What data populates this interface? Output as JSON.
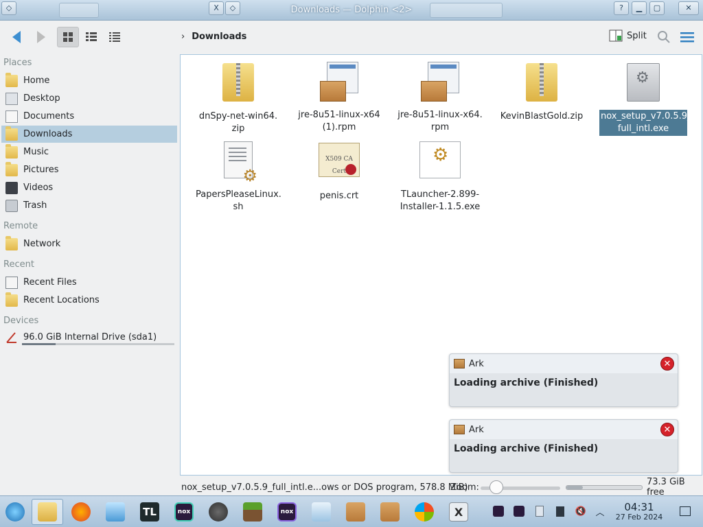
{
  "window": {
    "title": "Downloads — Dolphin <2>"
  },
  "toolbar": {
    "split_label": "Split"
  },
  "breadcrumb": {
    "current": "Downloads"
  },
  "sidebar": {
    "sections": {
      "places": "Places",
      "remote": "Remote",
      "recent": "Recent",
      "devices": "Devices"
    },
    "places": [
      {
        "label": "Home",
        "icon": "home-icon"
      },
      {
        "label": "Desktop",
        "icon": "desktop-icon"
      },
      {
        "label": "Documents",
        "icon": "documents-icon"
      },
      {
        "label": "Downloads",
        "icon": "downloads-icon"
      },
      {
        "label": "Music",
        "icon": "music-icon"
      },
      {
        "label": "Pictures",
        "icon": "pictures-icon"
      },
      {
        "label": "Videos",
        "icon": "videos-icon"
      },
      {
        "label": "Trash",
        "icon": "trash-icon"
      }
    ],
    "remote": [
      {
        "label": "Network",
        "icon": "network-icon"
      }
    ],
    "recent": [
      {
        "label": "Recent Files",
        "icon": "recent-files-icon"
      },
      {
        "label": "Recent Locations",
        "icon": "recent-locations-icon"
      }
    ],
    "devices": [
      {
        "label": "96.0 GiB Internal Drive (sda1)",
        "icon": "drive-icon",
        "usage_fraction": 0.22
      }
    ]
  },
  "files": [
    {
      "line1": "dnSpy-net-win64.",
      "line2": "zip",
      "type": "zip"
    },
    {
      "line1": "jre-8u51-linux-x64",
      "line2": "(1).rpm",
      "type": "rpm"
    },
    {
      "line1": "jre-8u51-linux-x64.",
      "line2": "rpm",
      "type": "rpm"
    },
    {
      "line1": "KevinBlastGold.zip",
      "line2": "",
      "type": "zip"
    },
    {
      "line1": "nox_setup_v7.0.5.9_",
      "line2": "full_intl.exe",
      "type": "exe",
      "selected": true
    },
    {
      "line1": "PapersPleaseLinux.",
      "line2": "sh",
      "type": "script"
    },
    {
      "line1": "penis.crt",
      "line2": "",
      "type": "cert",
      "cert_text": "X509 CA Cert"
    },
    {
      "line1": "TLauncher-2.899-",
      "line2": "Installer-1.1.5.exe",
      "type": "tlauncher"
    }
  ],
  "notifications": [
    {
      "app": "Ark",
      "message": "Loading archive (Finished)"
    },
    {
      "app": "Ark",
      "message": "Loading archive (Finished)"
    }
  ],
  "statusbar": {
    "selection_info": "nox_setup_v7.0.5.9_full_intl.e...ows or DOS program, 578.8 MiB)",
    "zoom_label": "Zoom:",
    "zoom_level": 0.2,
    "free_space": "73.3 GiB free",
    "used_fraction": 0.22
  },
  "taskbar": {
    "time": "04:31",
    "date": "27 Feb 2024",
    "apps": [
      "start-menu",
      "file-manager",
      "firefox",
      "remote-desktop",
      "tlauncher",
      "nox-player",
      "gauge-app",
      "minecraft",
      "nox-player-2",
      "package-installer",
      "ark-archive",
      "ark-archive-2",
      "windows-app",
      "x-app"
    ],
    "tlauncher_label": "TL"
  },
  "colors": {
    "selection": "#b5cedf",
    "file_selection": "#4d7a94",
    "accent": "#3d8fd1",
    "close_red": "#d5222a"
  }
}
